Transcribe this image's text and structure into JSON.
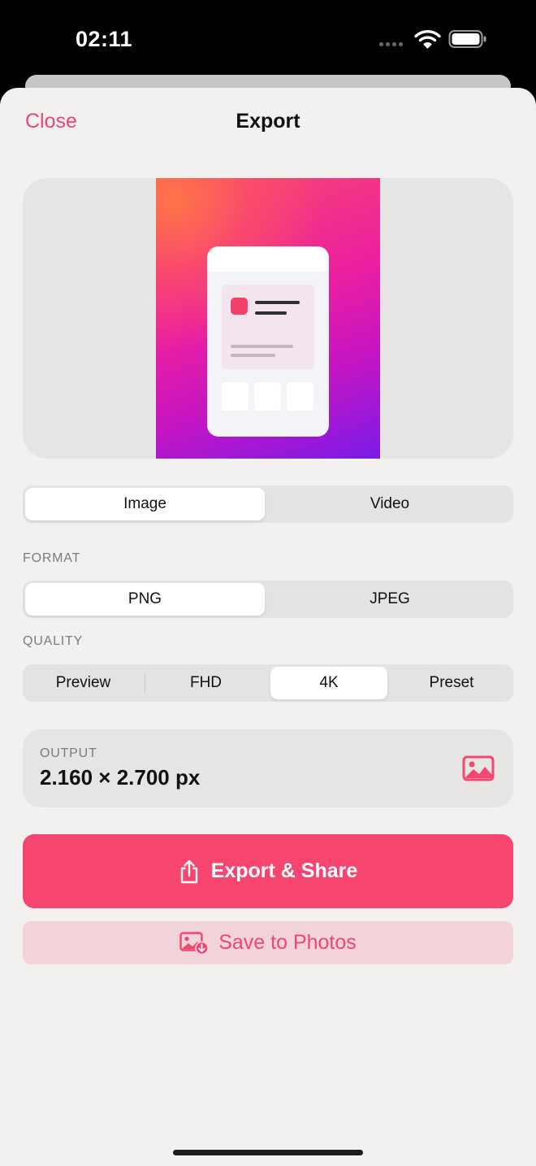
{
  "status_bar": {
    "time": "02:11"
  },
  "nav": {
    "close_label": "Close",
    "title": "Export"
  },
  "mode_selector": {
    "options": [
      "Image",
      "Video"
    ],
    "selected": "Image"
  },
  "format": {
    "label": "FORMAT",
    "options": [
      "PNG",
      "JPEG"
    ],
    "selected": "PNG"
  },
  "quality": {
    "label": "QUALITY",
    "options": [
      "Preview",
      "FHD",
      "4K",
      "Preset"
    ],
    "selected": "4K"
  },
  "output": {
    "label": "OUTPUT",
    "value": "2.160 × 2.700 px",
    "icon": "photo-icon"
  },
  "actions": {
    "export_share_label": "Export & Share",
    "export_share_icon": "share-icon",
    "save_photos_label": "Save to Photos",
    "save_photos_icon": "save-to-photos-icon"
  },
  "colors": {
    "accent": "#f6456f",
    "accent_soft": "#f2d3d9",
    "sheet_background": "#f2f1ef"
  }
}
